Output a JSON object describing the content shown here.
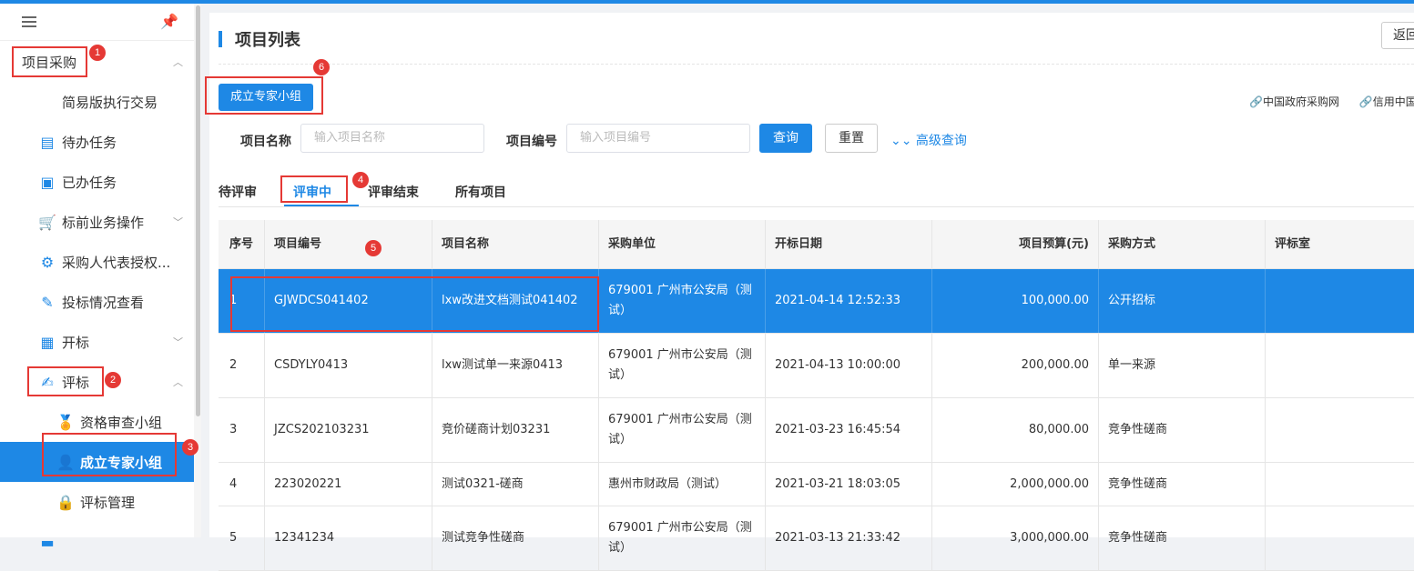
{
  "sidebar": {
    "items": [
      {
        "label": "项目采购",
        "icon": "none"
      },
      {
        "label": "简易版执行交易",
        "icon": "none"
      },
      {
        "label": "待办任务",
        "icon": "task-list-icon"
      },
      {
        "label": "已办任务",
        "icon": "done-task-icon"
      },
      {
        "label": "标前业务操作",
        "icon": "cart-icon"
      },
      {
        "label": "采购人代表授权...",
        "icon": "gear-icon"
      },
      {
        "label": "投标情况查看",
        "icon": "edit-icon"
      },
      {
        "label": "开标",
        "icon": "document-icon"
      },
      {
        "label": "评标",
        "icon": "review-icon"
      },
      {
        "label": "资格审查小组",
        "icon": "medal-icon"
      },
      {
        "label": "成立专家小组",
        "icon": "user-icon"
      },
      {
        "label": "评标管理",
        "icon": "lock-icon"
      }
    ]
  },
  "annotations": [
    "1",
    "2",
    "3",
    "4",
    "5",
    "6"
  ],
  "main": {
    "title": "项目列表",
    "back_label": "返回",
    "create_button": "成立专家小组",
    "ext_links": [
      "🔗中国政府采购网",
      "🔗信用中国"
    ],
    "search": {
      "name_label": "项目名称",
      "name_placeholder": "输入项目名称",
      "code_label": "项目编号",
      "code_placeholder": "输入项目编号",
      "query_label": "查询",
      "reset_label": "重置",
      "advanced_label": "高级查询"
    },
    "tabs": [
      "待评审",
      "评审中",
      "评审结束",
      "所有项目"
    ],
    "table": {
      "headers": [
        "序号",
        "项目编号",
        "项目名称",
        "采购单位",
        "开标日期",
        "项目预算(元)",
        "采购方式",
        "评标室"
      ],
      "rows": [
        [
          "1",
          "GJWDCS041402",
          "lxw改进文档测试041402",
          "679001 广州市公安局（测试）",
          "2021-04-14 12:52:33",
          "100,000.00",
          "公开招标",
          ""
        ],
        [
          "2",
          "CSDYLY0413",
          "lxw测试单一来源0413",
          "679001 广州市公安局（测试）",
          "2021-04-13 10:00:00",
          "200,000.00",
          "单一来源",
          ""
        ],
        [
          "3",
          "JZCS202103231",
          "竞价磋商计划03231",
          "679001 广州市公安局（测试）",
          "2021-03-23 16:45:54",
          "80,000.00",
          "竞争性磋商",
          ""
        ],
        [
          "4",
          "223020221",
          "测试0321-磋商",
          "惠州市财政局（测试）",
          "2021-03-21 18:03:05",
          "2,000,000.00",
          "竞争性磋商",
          ""
        ],
        [
          "5",
          "12341234",
          "测试竞争性磋商",
          "679001 广州市公安局（测试）",
          "2021-03-13 21:33:42",
          "3,000,000.00",
          "竞争性磋商",
          ""
        ]
      ]
    }
  }
}
